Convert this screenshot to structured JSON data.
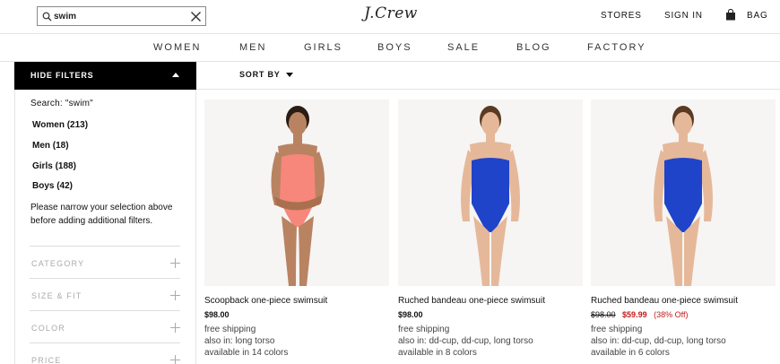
{
  "search": {
    "value": "swim"
  },
  "header": {
    "logo": "J.Crew",
    "stores": "STORES",
    "sign_in": "SIGN IN",
    "bag": "BAG"
  },
  "nav": [
    "WOMEN",
    "MEN",
    "GIRLS",
    "BOYS",
    "SALE",
    "BLOG",
    "FACTORY"
  ],
  "toolbar": {
    "hide_filters": "HIDE FILTERS",
    "sort_by": "SORT BY"
  },
  "sidebar": {
    "search_label": "Search: \"swim\"",
    "genders": [
      {
        "label": "Women (213)"
      },
      {
        "label": "Men (18)"
      },
      {
        "label": "Girls (188)"
      },
      {
        "label": "Boys (42)"
      }
    ],
    "narrow_note": "Please narrow your selection above before adding additional filters.",
    "facets": [
      "CATEGORY",
      "SIZE & FIT",
      "COLOR",
      "PRICE"
    ]
  },
  "products": [
    {
      "name": "Scoopback one-piece swimsuit",
      "price": "$98.00",
      "shipping": "free shipping",
      "also_in": "also in: long torso",
      "colors": "available in 14 colors",
      "swimsuit_color": "#f7877a"
    },
    {
      "name": "Ruched bandeau one-piece swimsuit",
      "price": "$98.00",
      "shipping": "free shipping",
      "also_in": "also in: dd-cup, dd-cup, long torso",
      "colors": "available in 8 colors",
      "swimsuit_color": "#1f44c9"
    },
    {
      "name": "Ruched bandeau one-piece swimsuit",
      "price_original": "$98.00",
      "price_sale": "$59.99",
      "discount": "(38% Off)",
      "shipping": "free shipping",
      "also_in": "also in: dd-cup, dd-cup, long torso",
      "colors": "available in 6 colors",
      "swimsuit_color": "#1f44c9"
    }
  ],
  "colors": {
    "sale_red": "#c4191a",
    "filter_button_bg": "#000000"
  }
}
